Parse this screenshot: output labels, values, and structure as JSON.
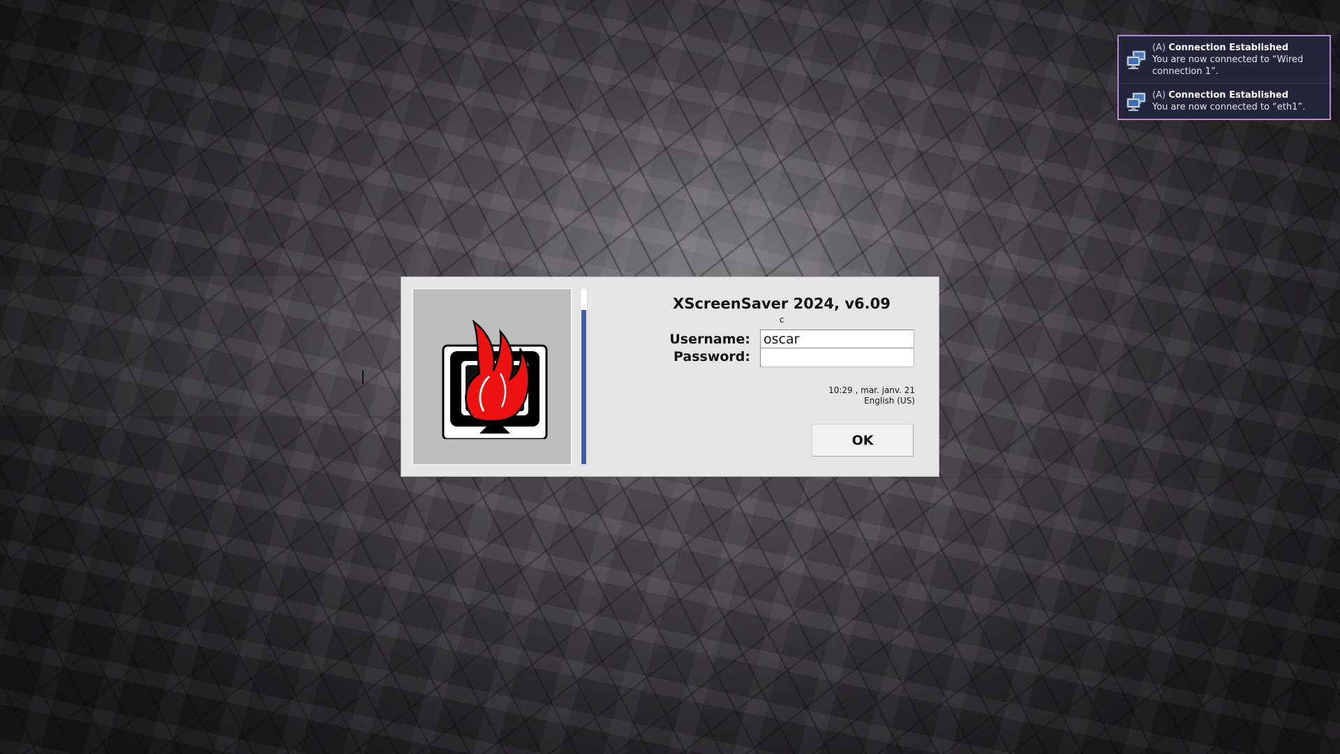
{
  "notifications": [
    {
      "app": "(A)",
      "summary": "Connection Established",
      "body": "You are now connected to “Wired connection 1”.",
      "icon": "network-computer-icon"
    },
    {
      "app": "(A)",
      "summary": "Connection Established",
      "body": "You are now connected to “eth1”.",
      "icon": "network-computer-icon"
    }
  ],
  "dialog": {
    "title": "XScreenSaver 2024, v6.09",
    "subtitle": "c",
    "logo_icon": "xscreensaver-flame-monitor-icon",
    "thermometer_level": 0.88,
    "username_label": "Username:",
    "username_value": "oscar",
    "password_label": "Password:",
    "password_value": "",
    "datetime": "10:29 , mar. janv. 21",
    "keyboard_layout": "English (US)",
    "ok_label": "OK"
  },
  "colors": {
    "notification_border": "#b98ad6",
    "notification_background": "#23253a",
    "dialog_background": "#e6e6e6",
    "thermometer_fill": "#3d5ba9",
    "logo_flame": "#ee1111"
  }
}
